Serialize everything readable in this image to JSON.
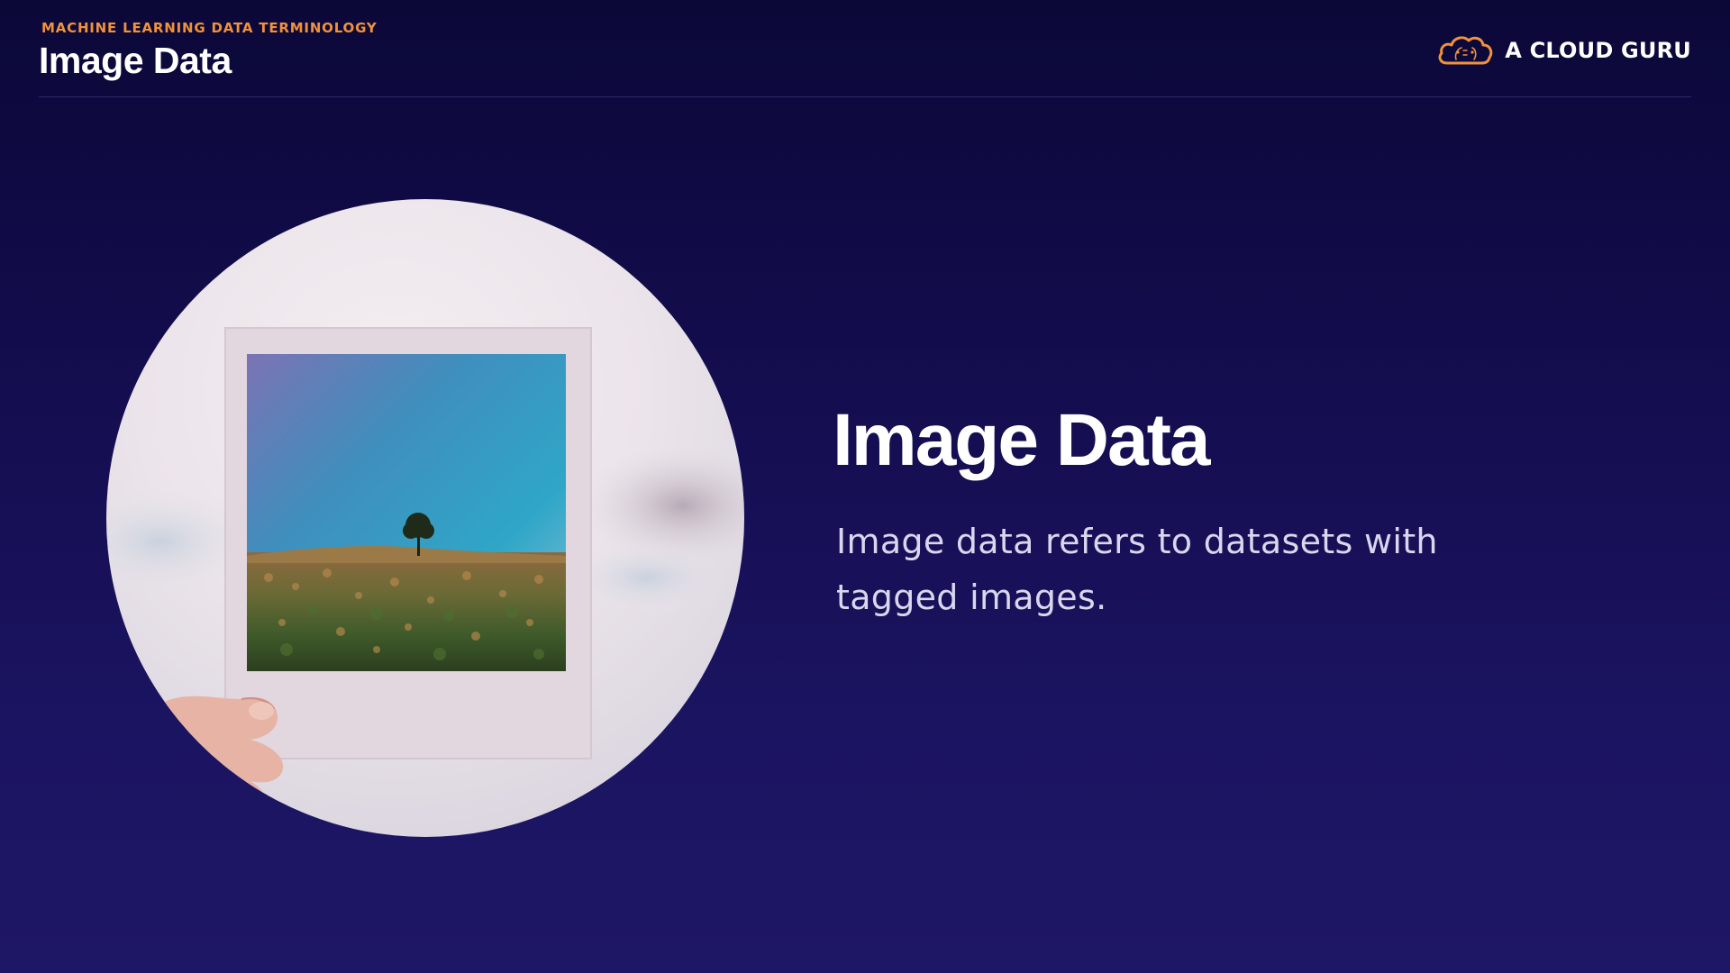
{
  "header": {
    "eyebrow": "MACHINE LEARNING DATA TERMINOLOGY",
    "title": "Image Data"
  },
  "brand": {
    "name": "A CLOUD GURU",
    "logo_icon": "cloud-icon",
    "accent_color": "#f0923a"
  },
  "slide": {
    "title": "Image Data",
    "description": "Image data refers to datasets with tagged images.",
    "illustration": "polaroid-photo"
  },
  "colors": {
    "background_top": "#0b0838",
    "background_bottom": "#1e1766",
    "accent": "#f0923a",
    "text": "#ffffff",
    "body_text": "#d9d7ee"
  }
}
